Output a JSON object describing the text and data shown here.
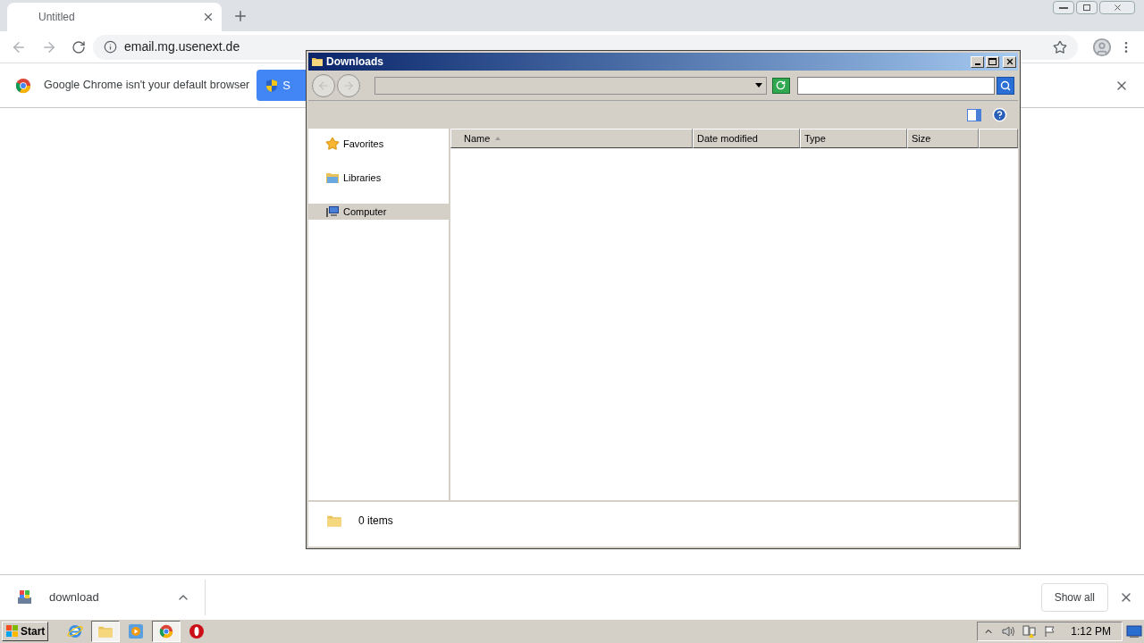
{
  "browser": {
    "tab": {
      "title": "Untitled"
    },
    "address": "email.mg.usenext.de",
    "infobar": {
      "message": "Google Chrome isn't your default browser",
      "button": "S"
    },
    "download_shelf": {
      "file": "download",
      "show_all": "Show all"
    }
  },
  "explorer": {
    "title": "Downloads",
    "nav": [
      {
        "label": "Favorites",
        "kind": "star",
        "selected": false
      },
      {
        "label": "Libraries",
        "kind": "library",
        "selected": false
      },
      {
        "label": "Computer",
        "kind": "computer",
        "selected": true
      }
    ],
    "columns": [
      "Name",
      "Date modified",
      "Type",
      "Size"
    ],
    "status": "0 items"
  },
  "taskbar": {
    "start": "Start",
    "apps": [
      {
        "kind": "ie",
        "selected": false
      },
      {
        "kind": "explorer",
        "selected": true
      },
      {
        "kind": "media",
        "selected": false
      },
      {
        "kind": "chrome",
        "selected": true
      },
      {
        "kind": "opera",
        "selected": false
      }
    ],
    "clock": "1:12 PM"
  }
}
